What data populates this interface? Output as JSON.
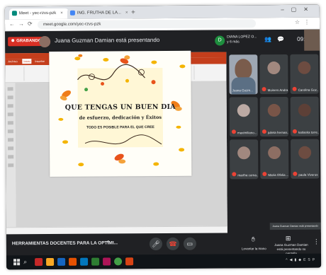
{
  "browser": {
    "tabs": [
      {
        "label": "Meet - yec-rzvs-pzk"
      },
      {
        "label": "ING. FRUTHA DE LA..."
      }
    ],
    "url": "meet.google.com/yec-rzvs-pzk"
  },
  "meet": {
    "recording_label": "GRABANDO",
    "presenting_text": "Juana Guzman Damian está presentando",
    "chip_initial": "D",
    "chip_name": "DIANA LOPEZ O...",
    "chip_sub": "y 6 más",
    "clock": "09:12",
    "meeting_name": "HERRAMIENTAS DOCENTES PARA LA OPTIMI...",
    "raise_hand_label": "Levantar la mano",
    "present_label": "Juana Guzman Damian está presentando su pantalla",
    "toast": "Juana Guzman Damian está presentando"
  },
  "powerpoint": {
    "title": "Sin título - PowerPoint",
    "tabs": [
      "Archivo",
      "Inicio",
      "Insertar",
      "Diseño",
      "Transiciones",
      "Animaciones",
      "Presentación",
      "Revisar",
      "Vista",
      "Ayuda"
    ]
  },
  "slide": {
    "line1": "QUE TENGAS UN BUEN DIA",
    "line2": "de esfuerzo, dedicación y Éxitos",
    "line3": "TODO ES POSIBLE PARA EL QUE CREE"
  },
  "participants": [
    {
      "name": "Juana Guzm...",
      "color": "#8d6e63",
      "video": true
    },
    {
      "name": "Moisers Andra...",
      "color": "#a1887f"
    },
    {
      "name": "Carolina Goz...",
      "color": "#6d4c41"
    },
    {
      "name": "maximiliano...",
      "color": "#bcaaa4"
    },
    {
      "name": "julieta hernan...",
      "color": "#795548"
    },
    {
      "name": "katiaska torre...",
      "color": "#5d4037"
    },
    {
      "name": "martha corna...",
      "color": "#a1887f"
    },
    {
      "name": "Maria Ofelia ...",
      "color": "#8d6e63"
    },
    {
      "name": "paula Viveros",
      "color": "#6d4c41"
    }
  ],
  "colors": {
    "meet_bg": "#202124",
    "record_red": "#d93025",
    "powerpoint_orange": "#c43e1c",
    "mic_off_red": "#ea4335"
  }
}
